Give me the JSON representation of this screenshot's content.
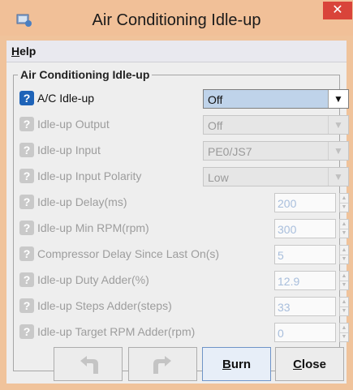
{
  "window": {
    "title": "Air Conditioning Idle-up",
    "close_glyph": "✕"
  },
  "menu": {
    "help_mnemonic": "H",
    "help_rest": "elp"
  },
  "group": {
    "title": "Air Conditioning Idle-up"
  },
  "rows": [
    {
      "label": "A/C Idle-up",
      "type": "combo",
      "value": "Off",
      "enabled": true
    },
    {
      "label": "Idle-up Output",
      "type": "combo",
      "value": "Off",
      "enabled": false
    },
    {
      "label": "Idle-up Input",
      "type": "combo",
      "value": "PE0/JS7",
      "enabled": false
    },
    {
      "label": "Idle-up Input Polarity",
      "type": "combo",
      "value": "Low",
      "enabled": false
    },
    {
      "label": "Idle-up Delay(ms)",
      "type": "spinner",
      "value": "200",
      "enabled": false
    },
    {
      "label": "Idle-up Min RPM(rpm)",
      "type": "spinner",
      "value": "300",
      "enabled": false
    },
    {
      "label": "Compressor Delay Since Last On(s)",
      "type": "spinner",
      "value": "5",
      "enabled": false
    },
    {
      "label": "Idle-up Duty Adder(%)",
      "type": "spinner",
      "value": "12.9",
      "enabled": false
    },
    {
      "label": "Idle-up Steps Adder(steps)",
      "type": "spinner",
      "value": "33",
      "enabled": false
    },
    {
      "label": "Idle-up Target RPM Adder(rpm)",
      "type": "spinner",
      "value": "0",
      "enabled": false
    }
  ],
  "help_icon_glyph": "?",
  "footer": {
    "burn_mnemonic": "B",
    "burn_rest": "urn",
    "close_mnemonic": "C",
    "close_rest": "lose"
  },
  "icons": [
    "app-icon",
    "help-icon",
    "dropdown-arrow-icon",
    "spinner-up-icon",
    "spinner-down-icon",
    "undo-icon",
    "redo-icon"
  ],
  "colors": {
    "titlebar": "#f1c098",
    "close": "#d9443a",
    "help_icon": "#1e63b8",
    "selected_combo": "#bfd3ea",
    "spinner_text": "#a8bedc"
  }
}
